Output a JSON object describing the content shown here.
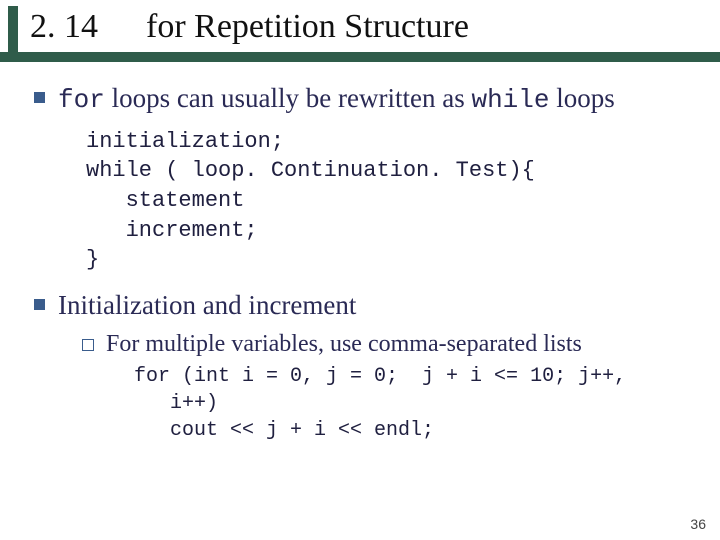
{
  "header": {
    "section_number": "2. 14",
    "section_title": "for Repetition Structure"
  },
  "bullets": {
    "b1_pre": "for",
    "b1_mid": " loops can usually be rewritten as ",
    "b1_post": "while",
    "b1_tail": " loops",
    "code1": "initialization;\nwhile ( loop. Continuation. Test){\n   statement\n   increment;\n}",
    "b2": "Initialization and increment",
    "sub1": "For multiple variables, use comma-separated lists",
    "code2": "for (int i = 0, j = 0;  j + i <= 10; j++,\n   i++)\n   cout << j + i << endl;"
  },
  "page_number": "36"
}
